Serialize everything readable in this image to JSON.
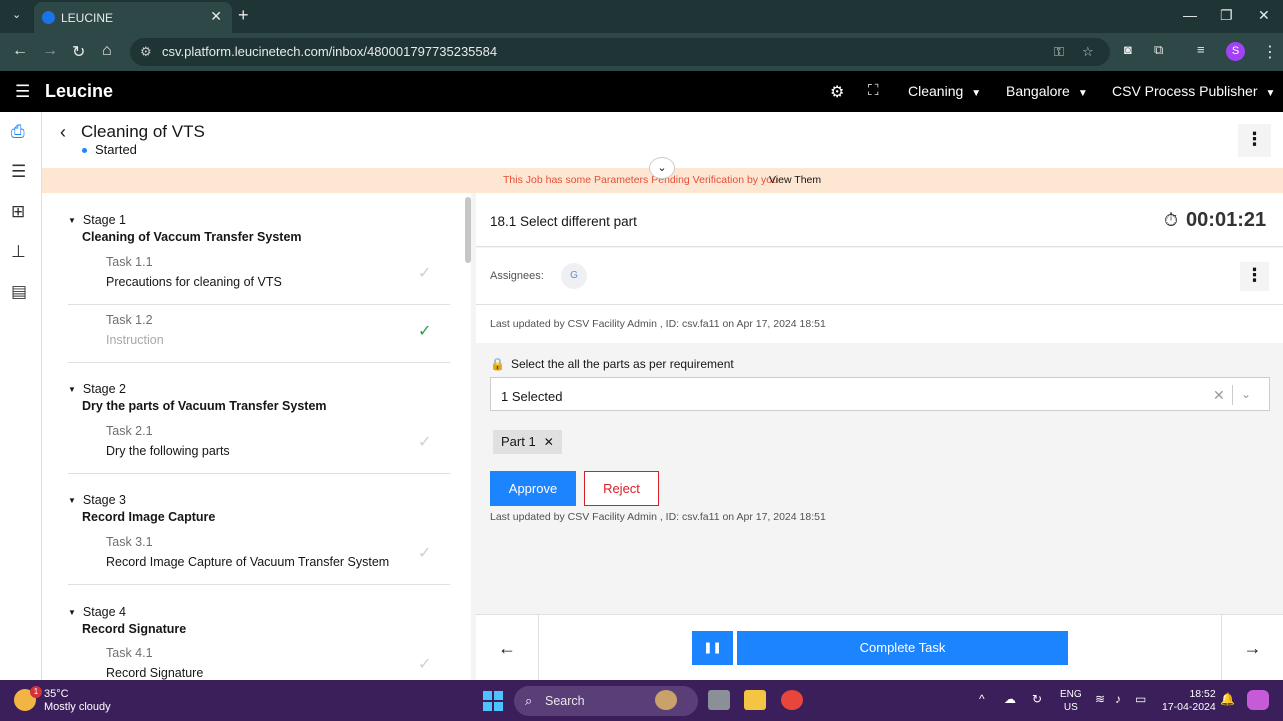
{
  "browser": {
    "tab_title": "LEUCINE",
    "url": "csv.platform.leucinetech.com/inbox/480001797735235584",
    "profile_initial": "S"
  },
  "app": {
    "logo": "Leucine",
    "facility": "Cleaning",
    "location": "Bangalore",
    "role": "CSV Process Publisher"
  },
  "job": {
    "title": "Cleaning of VTS",
    "state": "Started",
    "banner_warning": "This Job has some Parameters Pending Verification by you",
    "banner_link": "View Them"
  },
  "stages": [
    {
      "label": "Stage 1",
      "name": "Cleaning of Vaccum Transfer System",
      "tasks": [
        {
          "no": "Task 1.1",
          "name": "Precautions for cleaning of VTS",
          "done": false
        },
        {
          "no": "Task 1.2",
          "name": "Instruction",
          "done": true
        }
      ]
    },
    {
      "label": "Stage 2",
      "name": "Dry the parts of Vacuum Transfer System",
      "tasks": [
        {
          "no": "Task 2.1",
          "name": "Dry the following parts",
          "done": false
        }
      ]
    },
    {
      "label": "Stage 3",
      "name": "Record Image Capture",
      "tasks": [
        {
          "no": "Task 3.1",
          "name": "Record Image Capture of Vacuum Transfer System",
          "done": false
        }
      ]
    },
    {
      "label": "Stage 4",
      "name": "Record Signature",
      "tasks": [
        {
          "no": "Task 4.1",
          "name": "Record Signature",
          "done": false
        }
      ]
    }
  ],
  "task_panel": {
    "title": "18.1 Select different part",
    "timer": "00:01:21",
    "assignees_label": "Assignees:",
    "assignee_initial": "G",
    "last_updated": "Last updated by CSV Facility Admin , ID: csv.fa11 on Apr 17, 2024 18:51",
    "param_label": "Select the all the parts as per requirement",
    "select_value": "1 Selected",
    "chip": "Part 1",
    "approve": "Approve",
    "reject": "Reject",
    "last_updated_2": "Last updated by CSV Facility Admin , ID: csv.fa11 on Apr 17, 2024 18:51",
    "complete": "Complete Task"
  },
  "taskbar": {
    "temp": "35°C",
    "weather": "Mostly cloudy",
    "weather_badge": "1",
    "search": "Search",
    "lang1": "ENG",
    "lang2": "US",
    "time": "18:52",
    "date": "17-04-2024"
  },
  "colors": {
    "primary": "#1d84ff",
    "danger": "#da1e28",
    "success": "#24a148",
    "banner_bg": "#fde6d2"
  }
}
